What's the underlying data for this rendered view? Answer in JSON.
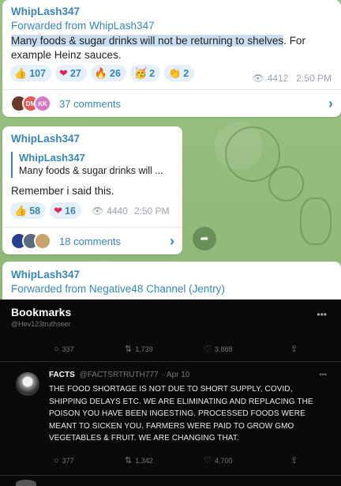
{
  "post1": {
    "sender": "WhipLash347",
    "forwarded": "Forwarded from WhipLash347",
    "text_highlight": "Many foods & sugar drinks will not be returning to shelves",
    "text_rest": ". For example Heinz sauces.",
    "reactions": [
      {
        "emoji": "👍",
        "icon": "thumbs-up-icon",
        "count": "107"
      },
      {
        "emoji": "❤",
        "icon": "heart-icon",
        "count": "27"
      },
      {
        "emoji": "🔥",
        "icon": "fire-icon",
        "count": "26"
      },
      {
        "emoji": "🥳",
        "icon": "party-face-icon",
        "count": "2"
      },
      {
        "emoji": "👏",
        "icon": "clap-icon",
        "count": "2"
      }
    ],
    "views": "4412",
    "time": "2:50 PM",
    "avatars": [
      "",
      "DM",
      "KK"
    ],
    "comments": "37 comments"
  },
  "post2": {
    "sender": "WhipLash347",
    "reply_sender": "WhipLash347",
    "reply_text": "Many foods & sugar drinks will ...",
    "text": "Remember i said this.",
    "reactions": [
      {
        "emoji": "👍",
        "icon": "thumbs-up-icon",
        "count": "58"
      },
      {
        "emoji": "❤",
        "icon": "heart-icon",
        "count": "16"
      }
    ],
    "views": "4440",
    "time": "2:50 PM",
    "comments": "18 comments"
  },
  "post3": {
    "sender": "WhipLash347",
    "forwarded": "Forwarded from Negative48 Channel (Jentry)"
  },
  "tweet": {
    "title": "Bookmarks",
    "handle": "@Hev123truthseer",
    "top_actions": {
      "replies": "337",
      "retweets": "1,739",
      "likes": "3,888"
    },
    "author_name": "FACTS",
    "author_handle": "@FACTSRTRUTH777",
    "date": "· Apr 10",
    "body": "The food shortage is not due to short supply, covid, shipping delays etc. We are eliminating and replacing the poison you have been ingesting. Processed foods were meant to sicken you. Farmers were paid to grow GMO vegetables & fruit. We are changing that.",
    "bottom_actions": {
      "replies": "377",
      "retweets": "1,342",
      "likes": "4,700"
    }
  },
  "colors": {
    "accent": "#3a86b3",
    "highlight": "#c9def0",
    "background": "#8fb77a"
  }
}
